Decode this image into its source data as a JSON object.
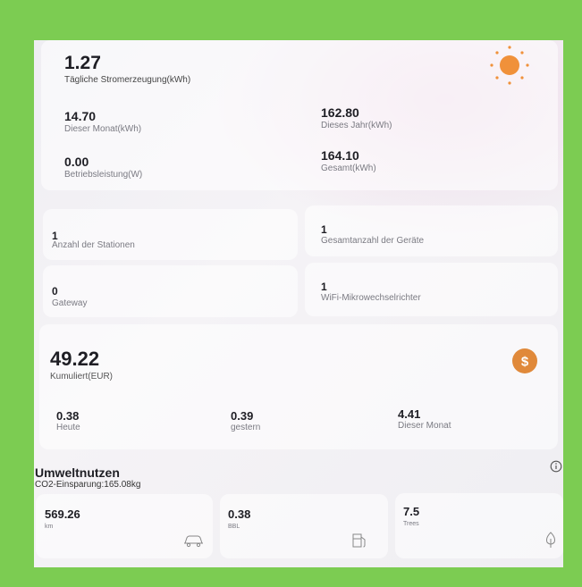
{
  "production": {
    "daily_value": "1.27",
    "daily_label": "Tägliche Stromerzeugung(kWh)",
    "month_value": "14.70",
    "month_label": "Dieser Monat(kWh)",
    "year_value": "162.80",
    "year_label": "Dieses Jahr(kWh)",
    "power_value": "0.00",
    "power_label": "Betriebsleistung(W)",
    "total_value": "164.10",
    "total_label": "Gesamt(kWh)"
  },
  "stations": [
    {
      "value": "1",
      "label": "Anzahl der Stationen"
    },
    {
      "value": "1",
      "label": "Gesamtanzahl der Geräte"
    },
    {
      "value": "0",
      "label": "Gateway"
    },
    {
      "value": "1",
      "label": "WiFi-Mikrowechselrichter"
    }
  ],
  "earnings": {
    "total_value": "49.22",
    "total_label": "Kumuliert(EUR)",
    "today_value": "0.38",
    "today_label": "Heute",
    "yesterday_value": "0.39",
    "yesterday_label": "gestern",
    "month_value": "4.41",
    "month_label": "Dieser Monat"
  },
  "environment": {
    "title": "Umweltnutzen",
    "co2": "CO2-Einsparung:165.08kg",
    "items": [
      {
        "value": "569.26",
        "label": "km",
        "icon": "car-icon"
      },
      {
        "value": "0.38",
        "label": "BBL",
        "icon": "fuel-icon"
      },
      {
        "value": "7.5",
        "label": "Trees",
        "icon": "tree-icon"
      }
    ]
  },
  "colors": {
    "background": "#7ccc52",
    "sun": "#f0913a",
    "coin": "#e0893a"
  }
}
